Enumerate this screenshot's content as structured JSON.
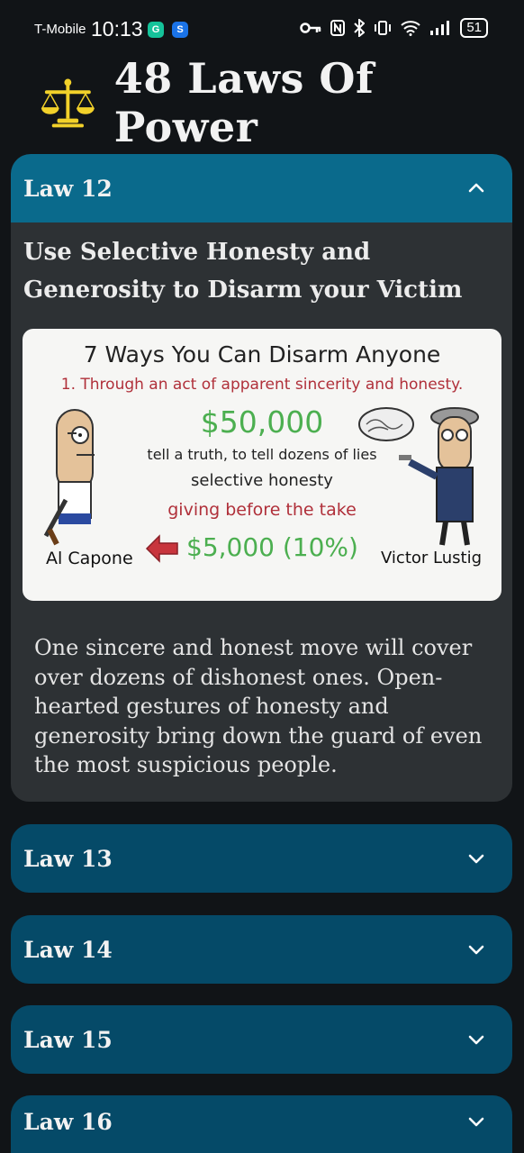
{
  "status_bar": {
    "carrier": "T-Mobile",
    "time": "10:13",
    "battery": "51"
  },
  "header": {
    "title": "48 Laws Of Power",
    "logo_icon": "scales-of-justice-icon"
  },
  "open_law": {
    "label": "Law 12",
    "title": "Use Selective Honesty and Generosity to Disarm your Victim",
    "image": {
      "heading": "7 Ways You Can Disarm Anyone",
      "point": "1. Through an act of apparent sincerity and honesty.",
      "amount_big": "$50,000",
      "line1": "tell a truth, to tell dozens of lies",
      "line2": "selective honesty",
      "line3": "giving before the take",
      "amount_small": "$5,000 (10%)",
      "left_name": "Al Capone",
      "right_name": "Victor Lustig"
    },
    "description": "One sincere and honest move will cover over dozens of dishonest ones. Open-hearted gestures of honesty and generosity bring down the guard of even the most suspicious people."
  },
  "closed_laws": [
    {
      "label": "Law 13"
    },
    {
      "label": "Law 14"
    },
    {
      "label": "Law 15"
    },
    {
      "label": "Law 16"
    }
  ],
  "colors": {
    "background": "#111417",
    "open_header": "#0a6a8c",
    "closed_header": "#054a68",
    "panel": "#2d3134",
    "money_green": "#4caf50",
    "accent_red": "#b0303a"
  }
}
